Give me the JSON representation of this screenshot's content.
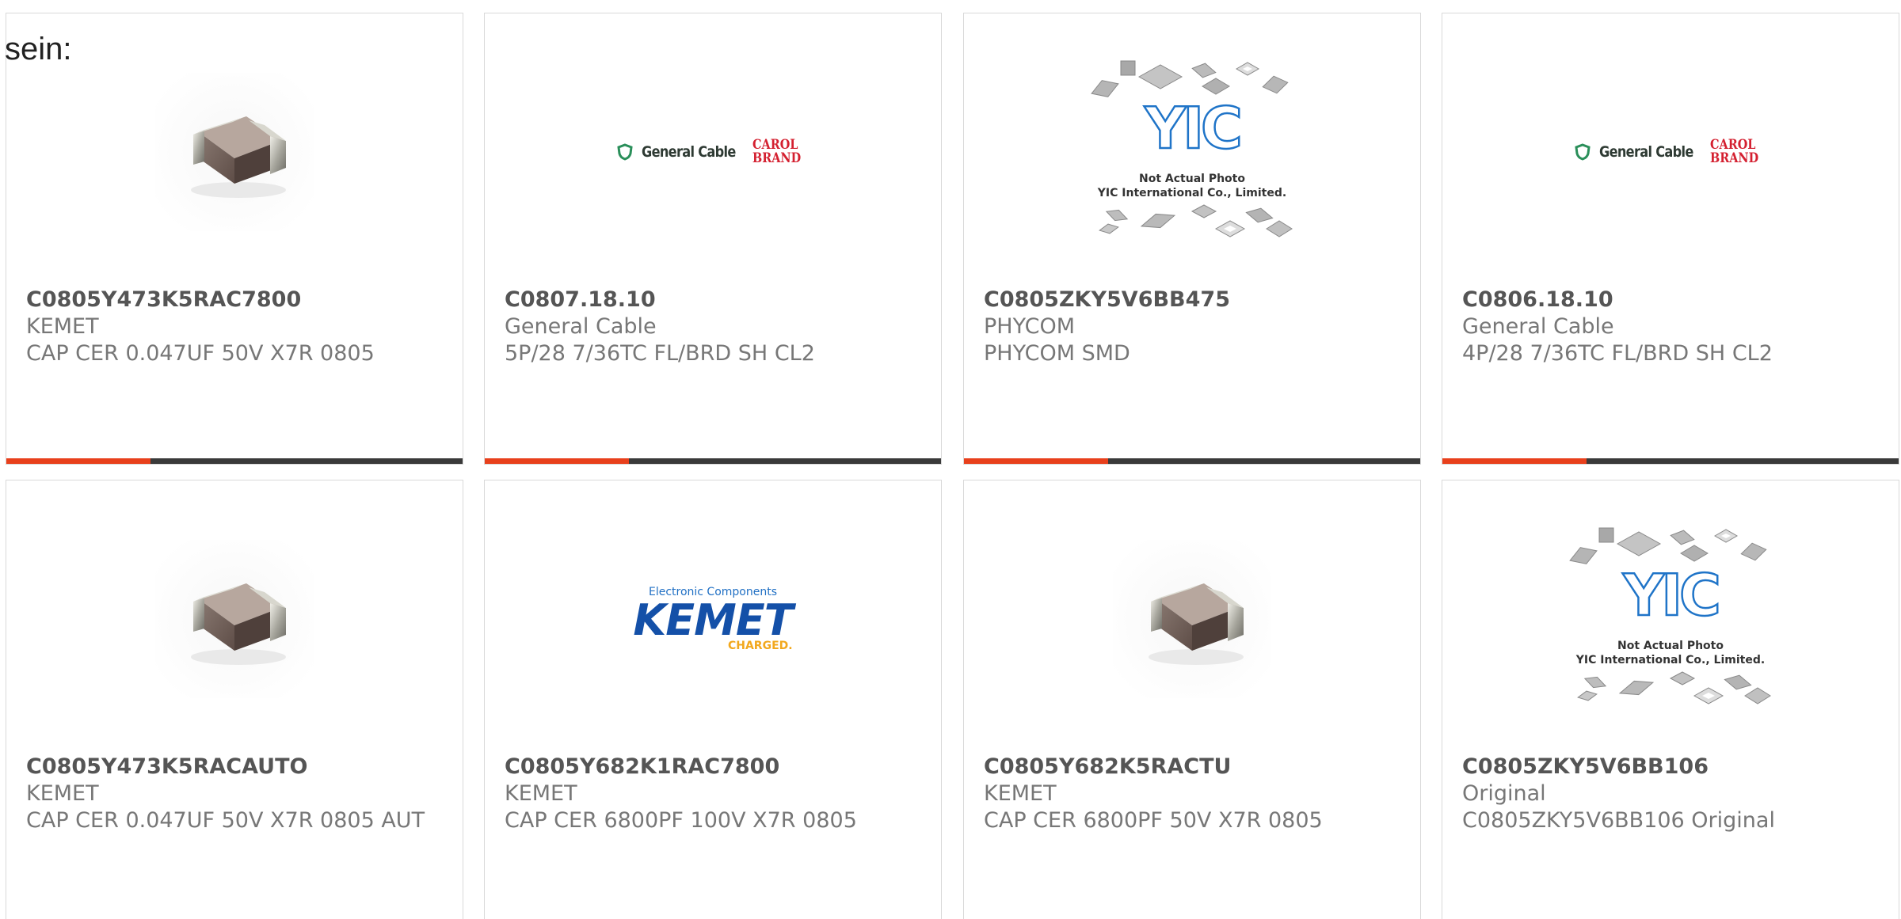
{
  "intro_text": "sein:",
  "cards": [
    {
      "part": "C0805Y473K5RAC7800",
      "maker": "KEMET",
      "desc": "CAP CER 0.047UF 50V X7R 0805",
      "image": "capacitor-chip",
      "accent_fraction": 0.316
    },
    {
      "part": "C0807.18.10",
      "maker": "General Cable",
      "desc": "5P/28 7/36TC FL/BRD SH CL2",
      "image": "general-cable-logo",
      "logo_name": "General Cable",
      "logo_brand_1": "CAROL",
      "logo_brand_2": "BRAND",
      "accent_fraction": 0.316
    },
    {
      "part": "C0805ZKY5V6BB475",
      "maker": "PHYCOM",
      "desc": "PHYCOM SMD",
      "image": "yic-placeholder",
      "caption_1": "Not Actual Photo",
      "caption_2": "YIC International Co., Limited.",
      "accent_fraction": 0.316
    },
    {
      "part": "C0806.18.10",
      "maker": "General Cable",
      "desc": "4P/28 7/36TC FL/BRD SH CL2",
      "image": "general-cable-logo",
      "logo_name": "General Cable",
      "logo_brand_1": "CAROL",
      "logo_brand_2": "BRAND",
      "accent_fraction": 0.316
    },
    {
      "part": "C0805Y473K5RACAUTO",
      "maker": "KEMET",
      "desc": "CAP CER 0.047UF 50V X7R 0805 AUT",
      "image": "capacitor-chip"
    },
    {
      "part": "C0805Y682K1RAC7800",
      "maker": "KEMET",
      "desc": "CAP CER 6800PF 100V X7R 0805",
      "image": "kemet-logo",
      "logo_top": "Electronic Components",
      "logo_main": "KEMET",
      "logo_sub": "CHARGED."
    },
    {
      "part": "C0805Y682K5RACTU",
      "maker": "KEMET",
      "desc": "CAP CER 6800PF 50V X7R 0805",
      "image": "capacitor-chip"
    },
    {
      "part": "C0805ZKY5V6BB106",
      "maker": "Original",
      "desc": "C0805ZKY5V6BB106 Original",
      "image": "yic-placeholder",
      "caption_1": "Not Actual Photo",
      "caption_2": "YIC International Co., Limited."
    }
  ],
  "colors": {
    "accent": "#e8401c",
    "bar_dark": "#3a3a3a",
    "part_text": "#555555",
    "meta_text": "#777777",
    "card_border": "#d9d9d9"
  }
}
